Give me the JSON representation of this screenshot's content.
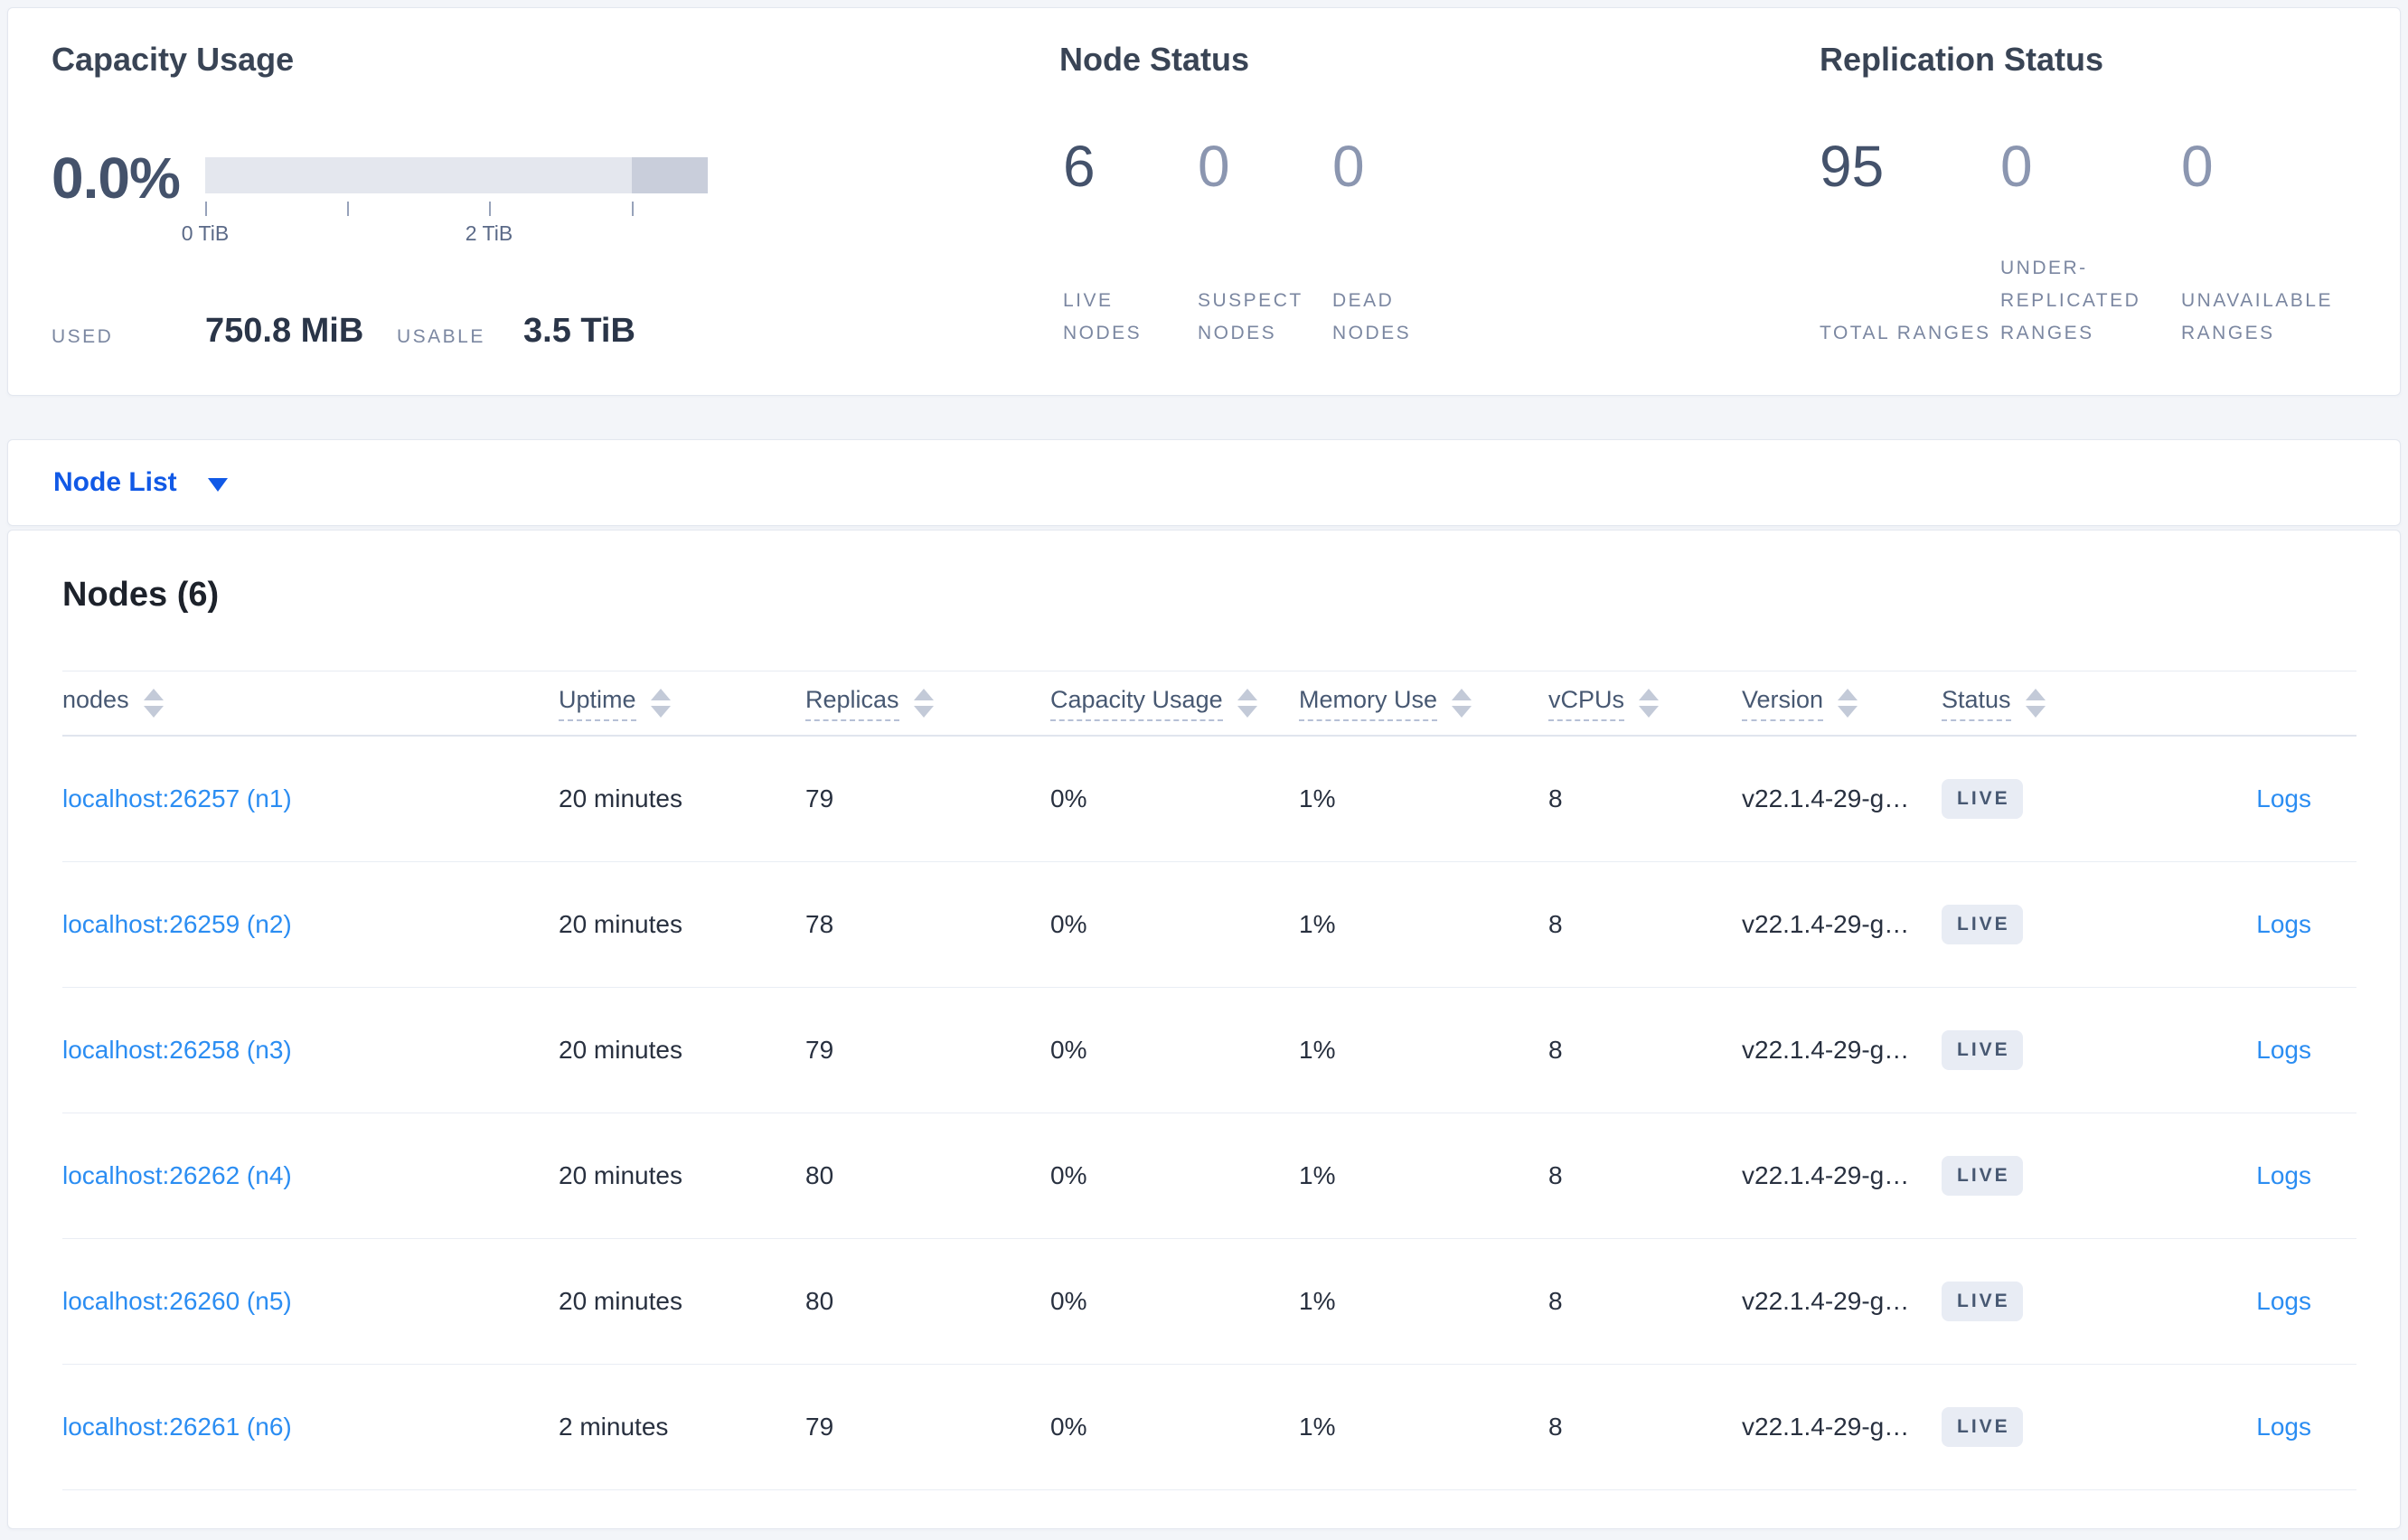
{
  "summary": {
    "capacity": {
      "title": "Capacity Usage",
      "percent": "0.0%",
      "ticks": [
        "0 TiB",
        "2 TiB"
      ],
      "used_label": "USED",
      "used_value": "750.8 MiB",
      "usable_label": "USABLE",
      "usable_value": "3.5 TiB"
    },
    "node_status": {
      "title": "Node Status",
      "stats": [
        {
          "value": "6",
          "label": "LIVE NODES",
          "emphasis": true
        },
        {
          "value": "0",
          "label": "SUSPECT NODES",
          "emphasis": false
        },
        {
          "value": "0",
          "label": "DEAD NODES",
          "emphasis": false
        }
      ]
    },
    "replication": {
      "title": "Replication Status",
      "stats": [
        {
          "value": "95",
          "label": "TOTAL RANGES",
          "emphasis": true
        },
        {
          "value": "0",
          "label": "UNDER-REPLICATED RANGES",
          "emphasis": false
        },
        {
          "value": "0",
          "label": "UNAVAILABLE RANGES",
          "emphasis": false
        }
      ]
    }
  },
  "selector": {
    "label": "Node List"
  },
  "table": {
    "title": "Nodes (6)",
    "columns": [
      {
        "label": "nodes",
        "key": "nodes",
        "underline": false
      },
      {
        "label": "Uptime",
        "key": "uptime",
        "underline": true
      },
      {
        "label": "Replicas",
        "key": "replicas",
        "underline": true
      },
      {
        "label": "Capacity Usage",
        "key": "capacity",
        "underline": true
      },
      {
        "label": "Memory Use",
        "key": "memory",
        "underline": true
      },
      {
        "label": "vCPUs",
        "key": "vcpus",
        "underline": true
      },
      {
        "label": "Version",
        "key": "version",
        "underline": true
      },
      {
        "label": "Status",
        "key": "status",
        "underline": true
      }
    ],
    "rows": [
      {
        "node": "localhost:26257 (n1)",
        "uptime": "20 minutes",
        "replicas": "79",
        "capacity": "0%",
        "memory": "1%",
        "vcpus": "8",
        "version": "v22.1.4-29-g…",
        "status": "LIVE",
        "logs": "Logs"
      },
      {
        "node": "localhost:26259 (n2)",
        "uptime": "20 minutes",
        "replicas": "78",
        "capacity": "0%",
        "memory": "1%",
        "vcpus": "8",
        "version": "v22.1.4-29-g…",
        "status": "LIVE",
        "logs": "Logs"
      },
      {
        "node": "localhost:26258 (n3)",
        "uptime": "20 minutes",
        "replicas": "79",
        "capacity": "0%",
        "memory": "1%",
        "vcpus": "8",
        "version": "v22.1.4-29-g…",
        "status": "LIVE",
        "logs": "Logs"
      },
      {
        "node": "localhost:26262 (n4)",
        "uptime": "20 minutes",
        "replicas": "80",
        "capacity": "0%",
        "memory": "1%",
        "vcpus": "8",
        "version": "v22.1.4-29-g…",
        "status": "LIVE",
        "logs": "Logs"
      },
      {
        "node": "localhost:26260 (n5)",
        "uptime": "20 minutes",
        "replicas": "80",
        "capacity": "0%",
        "memory": "1%",
        "vcpus": "8",
        "version": "v22.1.4-29-g…",
        "status": "LIVE",
        "logs": "Logs"
      },
      {
        "node": "localhost:26261 (n6)",
        "uptime": "2 minutes",
        "replicas": "79",
        "capacity": "0%",
        "memory": "1%",
        "vcpus": "8",
        "version": "v22.1.4-29-g…",
        "status": "LIVE",
        "logs": "Logs"
      }
    ]
  },
  "chart_data": {
    "type": "bar",
    "title": "Capacity Usage",
    "percent_used_label": "0.0%",
    "used": "750.8 MiB",
    "usable": "3.5 TiB",
    "axis_tick_values_tib": [
      0,
      1,
      2,
      3
    ],
    "axis_tick_labels_shown": [
      "0 TiB",
      "2 TiB"
    ],
    "bar_segments": [
      {
        "name": "usable-capacity",
        "fraction": 0.85,
        "color": "#e4e7ee"
      },
      {
        "name": "other-capacity",
        "fraction": 0.15,
        "color": "#c9cedb"
      }
    ]
  }
}
